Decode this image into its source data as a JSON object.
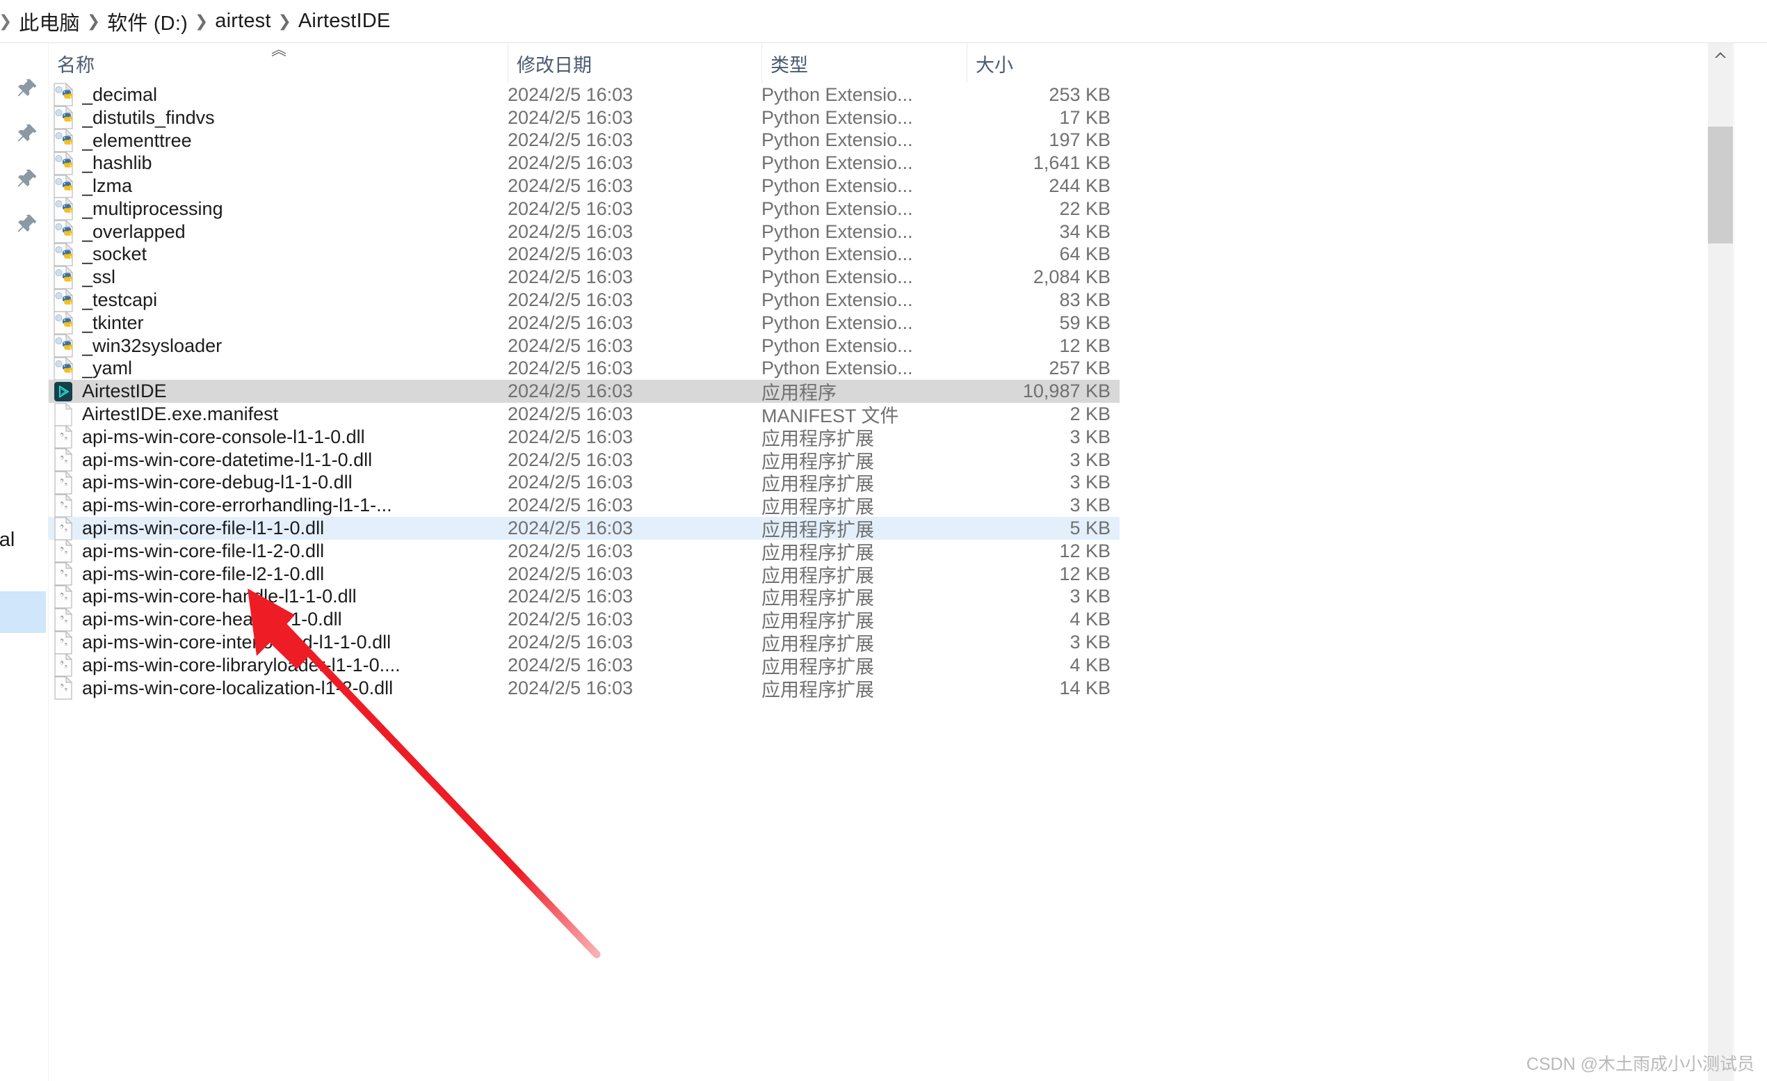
{
  "breadcrumb": {
    "items": [
      "此电脑",
      "软件 (D:)",
      "airtest",
      "AirtestIDE"
    ],
    "separator": "❯"
  },
  "sidebar": {
    "clipped_label": "sonal",
    "pin_icon_count": 4,
    "pin_icon_name": "pin-icon"
  },
  "columns": {
    "name": "名称",
    "date": "修改日期",
    "type": "类型",
    "size": "大小",
    "sort_indicator": "︿"
  },
  "colors": {
    "selected_row": "#d8d8d8",
    "hover_row": "#e3f0fb",
    "header_text": "#4a5a70",
    "annotation_arrow": "#ee1c25",
    "sidebar_selected": "#cfe6fb"
  },
  "annotation": {
    "type": "red-arrow",
    "points_to": "AirtestIDE",
    "color": "#ee1c25"
  },
  "watermark": "CSDN @木土雨成小小测试员",
  "files": [
    {
      "name": "_decimal",
      "date": "2024/2/5 16:03",
      "type": "Python Extensio...",
      "size": "253 KB",
      "icon": "python-file-icon",
      "state": ""
    },
    {
      "name": "_distutils_findvs",
      "date": "2024/2/5 16:03",
      "type": "Python Extensio...",
      "size": "17 KB",
      "icon": "python-file-icon",
      "state": ""
    },
    {
      "name": "_elementtree",
      "date": "2024/2/5 16:03",
      "type": "Python Extensio...",
      "size": "197 KB",
      "icon": "python-file-icon",
      "state": ""
    },
    {
      "name": "_hashlib",
      "date": "2024/2/5 16:03",
      "type": "Python Extensio...",
      "size": "1,641 KB",
      "icon": "python-file-icon",
      "state": ""
    },
    {
      "name": "_lzma",
      "date": "2024/2/5 16:03",
      "type": "Python Extensio...",
      "size": "244 KB",
      "icon": "python-file-icon",
      "state": ""
    },
    {
      "name": "_multiprocessing",
      "date": "2024/2/5 16:03",
      "type": "Python Extensio...",
      "size": "22 KB",
      "icon": "python-file-icon",
      "state": ""
    },
    {
      "name": "_overlapped",
      "date": "2024/2/5 16:03",
      "type": "Python Extensio...",
      "size": "34 KB",
      "icon": "python-file-icon",
      "state": ""
    },
    {
      "name": "_socket",
      "date": "2024/2/5 16:03",
      "type": "Python Extensio...",
      "size": "64 KB",
      "icon": "python-file-icon",
      "state": ""
    },
    {
      "name": "_ssl",
      "date": "2024/2/5 16:03",
      "type": "Python Extensio...",
      "size": "2,084 KB",
      "icon": "python-file-icon",
      "state": ""
    },
    {
      "name": "_testcapi",
      "date": "2024/2/5 16:03",
      "type": "Python Extensio...",
      "size": "83 KB",
      "icon": "python-file-icon",
      "state": ""
    },
    {
      "name": "_tkinter",
      "date": "2024/2/5 16:03",
      "type": "Python Extensio...",
      "size": "59 KB",
      "icon": "python-file-icon",
      "state": ""
    },
    {
      "name": "_win32sysloader",
      "date": "2024/2/5 16:03",
      "type": "Python Extensio...",
      "size": "12 KB",
      "icon": "python-file-icon",
      "state": ""
    },
    {
      "name": "_yaml",
      "date": "2024/2/5 16:03",
      "type": "Python Extensio...",
      "size": "257 KB",
      "icon": "python-file-icon",
      "state": ""
    },
    {
      "name": "AirtestIDE",
      "date": "2024/2/5 16:03",
      "type": "应用程序",
      "size": "10,987 KB",
      "icon": "airtest-app-icon",
      "state": "selected"
    },
    {
      "name": "AirtestIDE.exe.manifest",
      "date": "2024/2/5 16:03",
      "type": "MANIFEST 文件",
      "size": "2 KB",
      "icon": "blank-file-icon",
      "state": ""
    },
    {
      "name": "api-ms-win-core-console-l1-1-0.dll",
      "date": "2024/2/5 16:03",
      "type": "应用程序扩展",
      "size": "3 KB",
      "icon": "dll-file-icon",
      "state": ""
    },
    {
      "name": "api-ms-win-core-datetime-l1-1-0.dll",
      "date": "2024/2/5 16:03",
      "type": "应用程序扩展",
      "size": "3 KB",
      "icon": "dll-file-icon",
      "state": ""
    },
    {
      "name": "api-ms-win-core-debug-l1-1-0.dll",
      "date": "2024/2/5 16:03",
      "type": "应用程序扩展",
      "size": "3 KB",
      "icon": "dll-file-icon",
      "state": ""
    },
    {
      "name": "api-ms-win-core-errorhandling-l1-1-...",
      "date": "2024/2/5 16:03",
      "type": "应用程序扩展",
      "size": "3 KB",
      "icon": "dll-file-icon",
      "state": ""
    },
    {
      "name": "api-ms-win-core-file-l1-1-0.dll",
      "date": "2024/2/5 16:03",
      "type": "应用程序扩展",
      "size": "5 KB",
      "icon": "dll-file-icon",
      "state": "hover"
    },
    {
      "name": "api-ms-win-core-file-l1-2-0.dll",
      "date": "2024/2/5 16:03",
      "type": "应用程序扩展",
      "size": "12 KB",
      "icon": "dll-file-icon",
      "state": ""
    },
    {
      "name": "api-ms-win-core-file-l2-1-0.dll",
      "date": "2024/2/5 16:03",
      "type": "应用程序扩展",
      "size": "12 KB",
      "icon": "dll-file-icon",
      "state": ""
    },
    {
      "name": "api-ms-win-core-handle-l1-1-0.dll",
      "date": "2024/2/5 16:03",
      "type": "应用程序扩展",
      "size": "3 KB",
      "icon": "dll-file-icon",
      "state": ""
    },
    {
      "name": "api-ms-win-core-heap-l1-1-0.dll",
      "date": "2024/2/5 16:03",
      "type": "应用程序扩展",
      "size": "4 KB",
      "icon": "dll-file-icon",
      "state": ""
    },
    {
      "name": "api-ms-win-core-interlocked-l1-1-0.dll",
      "date": "2024/2/5 16:03",
      "type": "应用程序扩展",
      "size": "3 KB",
      "icon": "dll-file-icon",
      "state": ""
    },
    {
      "name": "api-ms-win-core-libraryloader-l1-1-0....",
      "date": "2024/2/5 16:03",
      "type": "应用程序扩展",
      "size": "4 KB",
      "icon": "dll-file-icon",
      "state": ""
    },
    {
      "name": "api-ms-win-core-localization-l1-2-0.dll",
      "date": "2024/2/5 16:03",
      "type": "应用程序扩展",
      "size": "14 KB",
      "icon": "dll-file-icon",
      "state": ""
    }
  ]
}
